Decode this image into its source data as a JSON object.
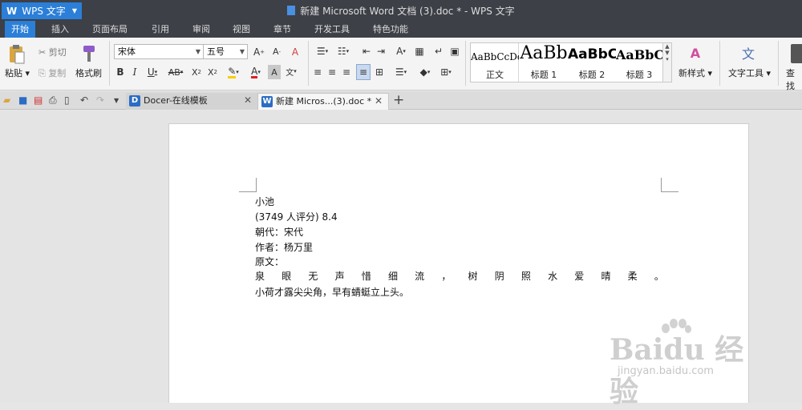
{
  "titlebar": {
    "app_button": "WPS 文字",
    "window_title": "新建 Microsoft Word 文档 (3).doc * - WPS 文字"
  },
  "menu": {
    "tabs": [
      "开始",
      "插入",
      "页面布局",
      "引用",
      "审阅",
      "视图",
      "章节",
      "开发工具",
      "特色功能"
    ]
  },
  "ribbon": {
    "paste": "粘贴",
    "cut": "剪切",
    "copy": "复制",
    "format_painter": "格式刷",
    "font_name": "宋体",
    "font_size": "五号",
    "styles": [
      {
        "sample": "AaBbCcDd",
        "label": "正文"
      },
      {
        "sample": "AaBb",
        "label": "标题 1"
      },
      {
        "sample": "AaBbC",
        "label": "标题 2"
      },
      {
        "sample": "AaBbC",
        "label": "标题 3"
      }
    ],
    "new_style": "新样式",
    "text_tools": "文字工具",
    "find": "查找"
  },
  "tabs": {
    "docer": "Docer-在线模板",
    "document": "新建 Micros...(3).doc *"
  },
  "document": {
    "lines": [
      "小池",
      "(3749 人评分) 8.4",
      "朝代：宋代",
      "作者：杨万里",
      "原文："
    ],
    "spaced_line": [
      "泉",
      "眼",
      "无",
      "声",
      "惜",
      "细",
      "流",
      "，",
      "树",
      "阴",
      "照",
      "水",
      "爱",
      "晴",
      "柔",
      "。"
    ],
    "last_line": "小荷才露尖尖角，早有蜻蜓立上头。"
  },
  "watermark": {
    "brand": "Baidu 经验",
    "url": "jingyan.baidu.com"
  },
  "colors": {
    "titlebar": "#3d4047",
    "accent": "#2b7fd8",
    "ribbon": "#f4f4f4"
  }
}
